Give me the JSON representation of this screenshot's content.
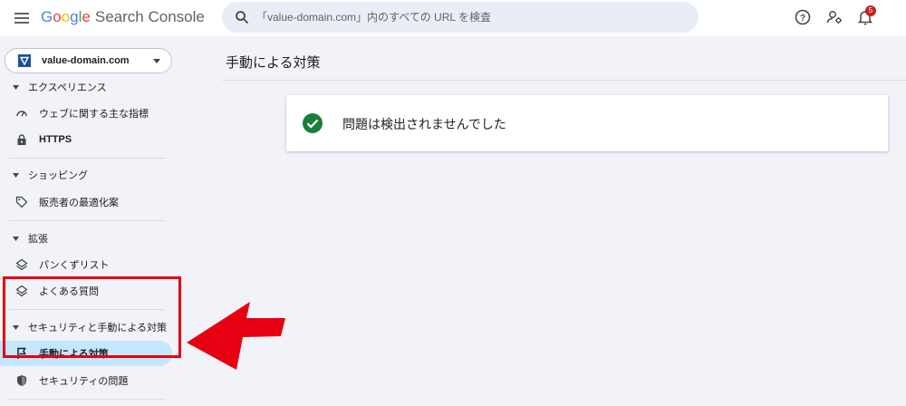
{
  "header": {
    "logo_google": [
      "G",
      "o",
      "o",
      "g",
      "l",
      "e"
    ],
    "logo_product": "Search Console",
    "search_placeholder": "「value-domain.com」内のすべての URL を検査",
    "notification_count": "5"
  },
  "sidebar": {
    "property": "value-domain.com",
    "sections": [
      {
        "title": "エクスペリエンス",
        "items": [
          {
            "label": "ウェブに関する主な指標",
            "icon": "gauge-icon"
          },
          {
            "label": "HTTPS",
            "icon": "lock-icon"
          }
        ]
      },
      {
        "title": "ショッピング",
        "items": [
          {
            "label": "販売者の最適化案",
            "icon": "tag-icon"
          }
        ]
      },
      {
        "title": "拡張",
        "items": [
          {
            "label": "パンくずリスト",
            "icon": "layers-icon"
          },
          {
            "label": "よくある質問",
            "icon": "layers-icon"
          }
        ]
      },
      {
        "title": "セキュリティと手動による対策",
        "items": [
          {
            "label": "手動による対策",
            "icon": "flag-icon",
            "active": true
          },
          {
            "label": "セキュリティの問題",
            "icon": "shield-icon"
          }
        ]
      }
    ]
  },
  "main": {
    "title": "手動による対策",
    "status_message": "問題は検出されませんでした"
  },
  "colors": {
    "accent_active": "#c2e7ff",
    "success": "#188038",
    "annotation_red": "#e60012"
  }
}
